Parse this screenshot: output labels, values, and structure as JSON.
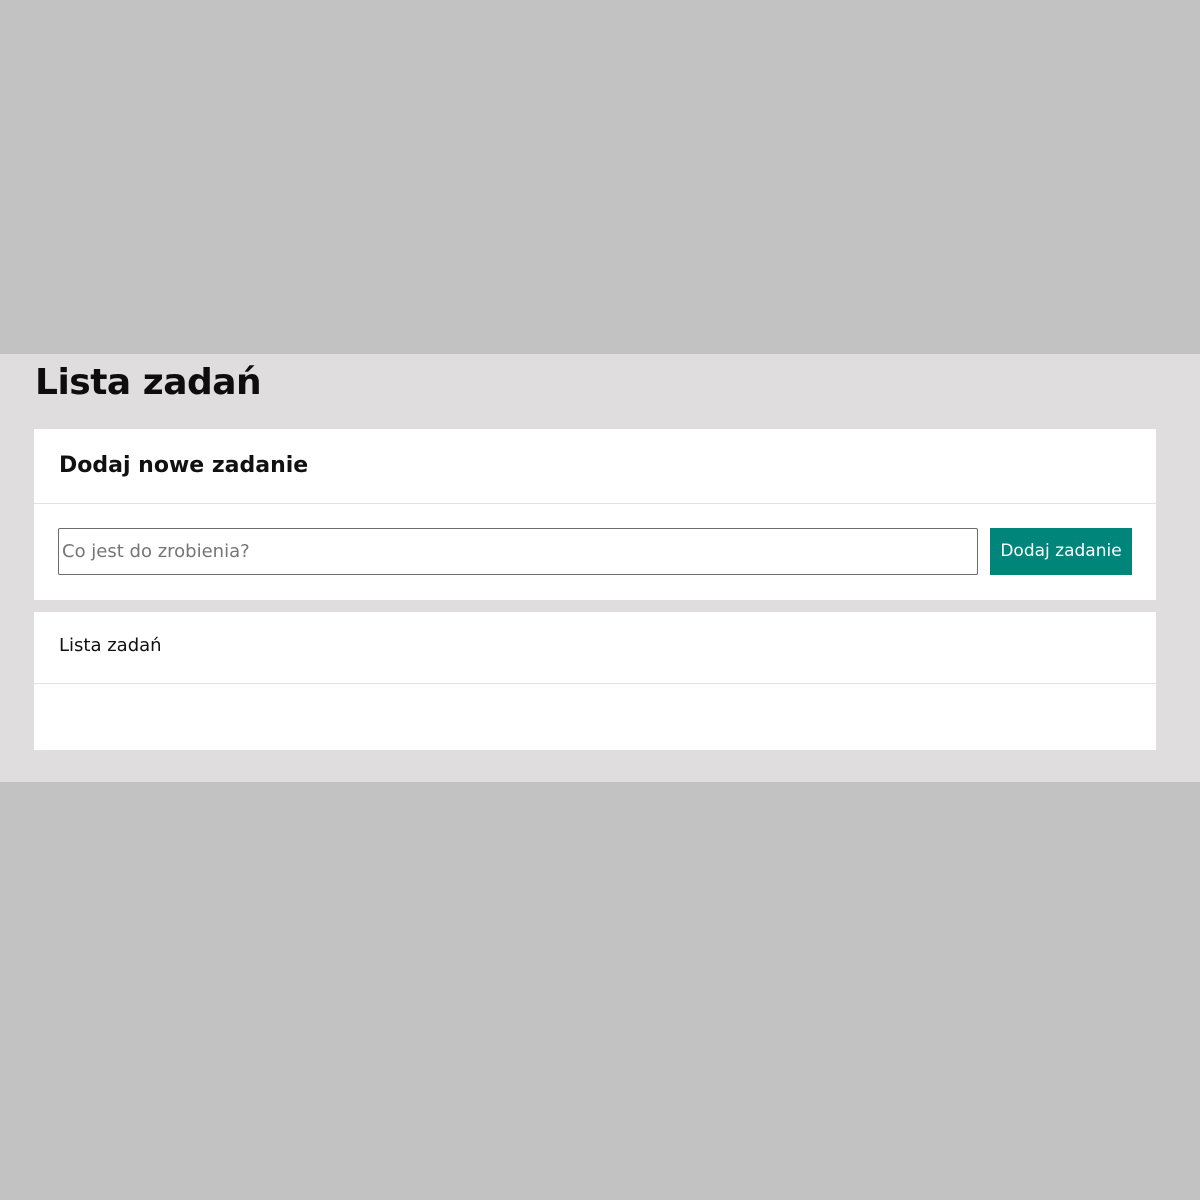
{
  "page": {
    "title": "Lista zadań"
  },
  "add_card": {
    "title": "Dodaj nowe zadanie",
    "input": {
      "value": "",
      "placeholder": "Co jest do zrobienia?"
    },
    "button_label": "Dodaj zadanie"
  },
  "list_card": {
    "title": "Lista zadań",
    "tasks": []
  },
  "colors": {
    "accent": "#00857a",
    "page_background": "#dfdddd",
    "card_background": "#ffffff"
  }
}
